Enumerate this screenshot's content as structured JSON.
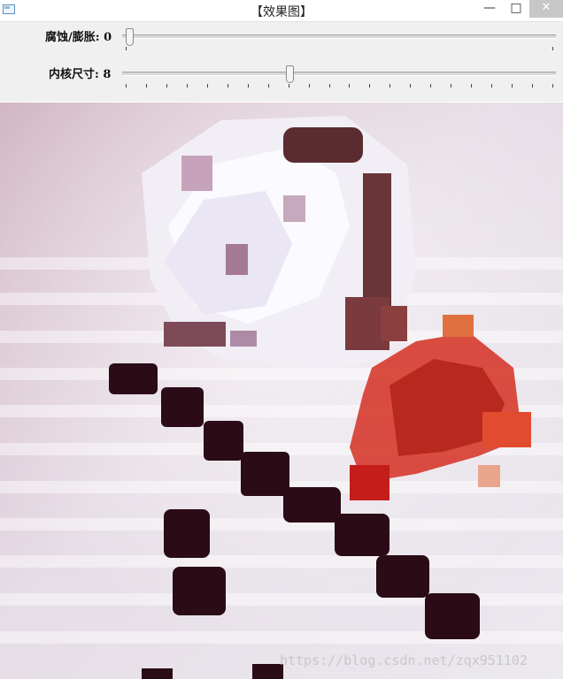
{
  "window": {
    "title": "【效果图】",
    "icon": "app-window-icon",
    "controls": {
      "minimize": "—",
      "maximize": "□",
      "close": "✕"
    }
  },
  "trackbars": [
    {
      "label": "腐蚀/膨胀: 0",
      "value": 0,
      "max": 1
    },
    {
      "label": "内核尺寸: 8",
      "value": 8,
      "max": 21
    }
  ],
  "image": {
    "description_icon": "eroded-rose-image",
    "watermark": "https://blog.csdn.net/zqx951102"
  },
  "colors": {
    "panel": "#f0f0f0",
    "close_hover": "#c7c7c7"
  }
}
